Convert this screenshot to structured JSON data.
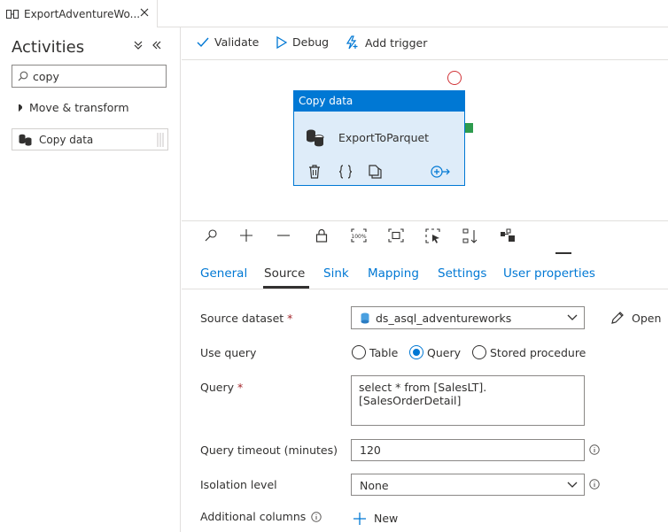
{
  "file_tab": {
    "title": "ExportAdventureWo..."
  },
  "activities": {
    "title": "Activities",
    "search_value": "copy",
    "category": "Move & transform",
    "item": "Copy data"
  },
  "toolbar": {
    "validate": "Validate",
    "debug": "Debug",
    "add_trigger": "Add trigger"
  },
  "node": {
    "header": "Copy data",
    "name": "ExportToParquet"
  },
  "prop_tabs": [
    "General",
    "Source",
    "Sink",
    "Mapping",
    "Settings",
    "User properties"
  ],
  "active_tab": "Source",
  "form": {
    "source_dataset_label": "Source dataset",
    "source_dataset_value": "ds_asql_adventureworks",
    "open_label": "Open",
    "use_query_label": "Use query",
    "radio_table": "Table",
    "radio_query": "Query",
    "radio_stored": "Stored procedure",
    "selected_radio": "Query",
    "query_label": "Query",
    "query_value": "select * from [SalesLT].[SalesOrderDetail]",
    "timeout_label": "Query timeout (minutes)",
    "timeout_value": "120",
    "isolation_label": "Isolation level",
    "isolation_value": "None",
    "additional_label": "Additional columns",
    "new_label": "New",
    "required_mark": "*"
  },
  "colors": {
    "accent": "#0078d4",
    "node_bg": "#deecf9",
    "error": "#d13438",
    "success": "#2e9b4e"
  }
}
